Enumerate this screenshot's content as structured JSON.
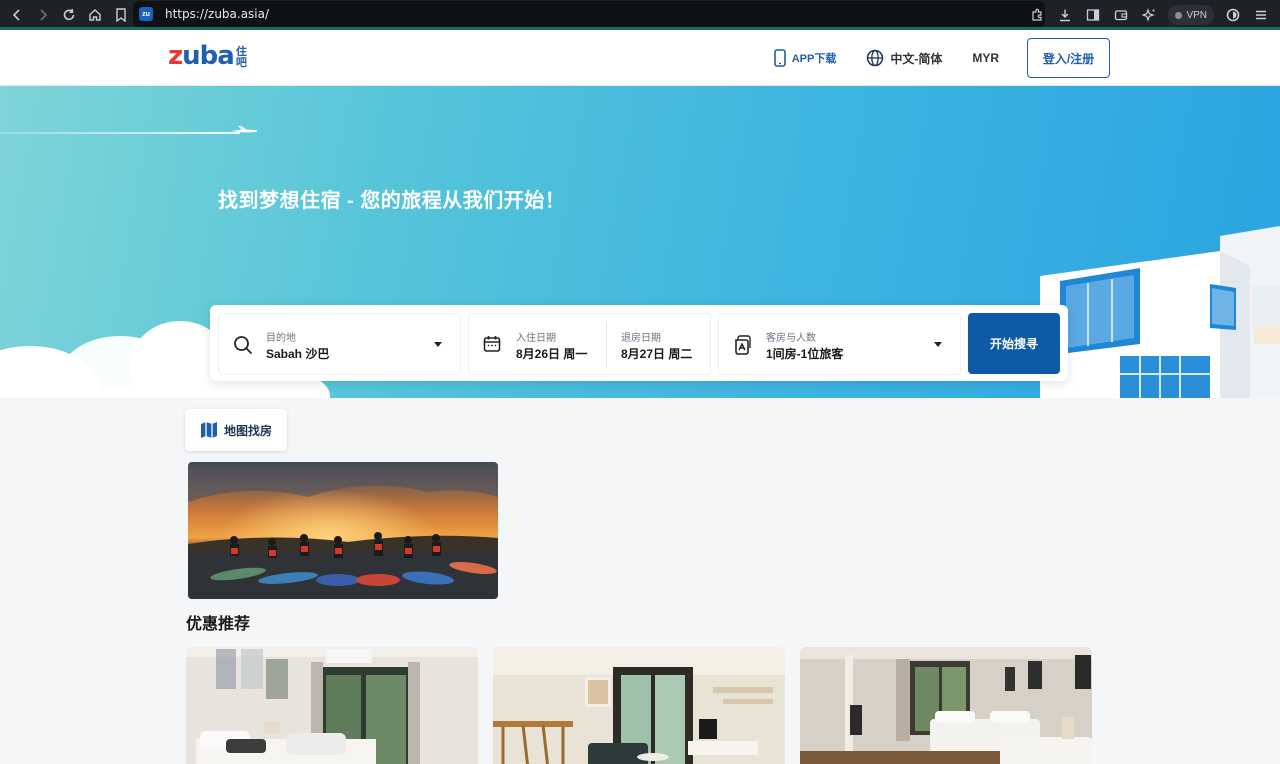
{
  "browser": {
    "url": "https://zuba.asia/",
    "favicon_text": "zu",
    "vpn_label": "VPN",
    "nav_icons": [
      "back-icon",
      "forward-icon",
      "reload-icon",
      "home-icon",
      "bookmark-icon"
    ],
    "toolbar_icons": [
      "extensions-icon",
      "download-icon",
      "sidebar-icon",
      "wallet-icon",
      "ai-icon",
      "profile-icon",
      "menu-icon"
    ]
  },
  "header": {
    "logo_word": "zuba",
    "logo_cn": "住吧",
    "app_download": "APP下载",
    "language": "中文-简体",
    "currency": "MYR",
    "login": "登入/注册"
  },
  "hero": {
    "title": "找到梦想住宿 - 您的旅程从我们开始！"
  },
  "search": {
    "destination_label": "目的地",
    "destination_value": "Sabah 沙巴",
    "checkin_label": "入住日期",
    "checkin_value": "8月26日 周一",
    "checkout_label": "退房日期",
    "checkout_value": "8月27日 周二",
    "guests_label": "客房与人数",
    "guests_value": "1间房-1位旅客",
    "button": "开始搜寻"
  },
  "content": {
    "map_search": "地图找房",
    "section_title": "优惠推荐"
  },
  "colors": {
    "brand_blue": "#1f5fae",
    "search_button": "#0f5aa7",
    "hero_start": "#7fd4d8",
    "hero_end": "#2aa4e0"
  }
}
